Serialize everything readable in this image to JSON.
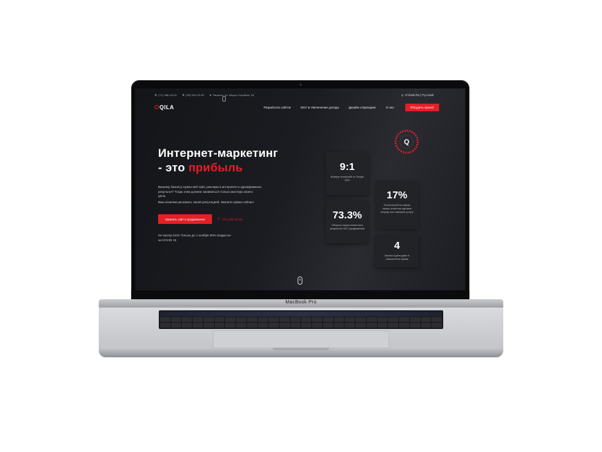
{
  "device": {
    "brand_label": "MacBook Pro"
  },
  "topbar": {
    "phone1": "(71) 288-43-00",
    "phone2": "(99) 900-20-50",
    "address": "Ташкент, ул. Мирзо Улугбека, 64",
    "languages": "O'zbekcha | Русский"
  },
  "navbar": {
    "logo": "QILA",
    "links": [
      "Разработка сайтов",
      "SEO & Увеличение дохода",
      "Дизайн и Брендинг",
      "О нас"
    ],
    "cta": "Обсудить проект"
  },
  "hero": {
    "title_line1": "Интернет-маркетинг",
    "title_line2_prefix": "- это ",
    "title_line2_accent": "прибыль",
    "desc1": "Вашему бизнесу нужен веб сайт, реклама в интернете и одновременно результат? Тогда этим должен заниматься только мастера своего дела.",
    "desc2": "Вам незачем рисковать своей репутацией. Звоните прямо сейчас!",
    "button": "Заказать сайт и продвижение",
    "phone": "(71) 288 43 00",
    "note": "Не пропустите! Только до 1 ноября 30% скидки из-за COVID 19"
  },
  "stats": [
    {
      "value": "9:1",
      "caption": "Возврат вложений от Google SEO"
    },
    {
      "value": "17%",
      "caption": "Посетителей на сайтах наших клиентов сделали покупку или заказали услугу"
    },
    {
      "value": "73.3%",
      "caption": "Оборота наших клиентов в результате SEO продвижения"
    },
    {
      "value": "4",
      "caption": "Звонка в день даже в назначенное время"
    }
  ],
  "badge": {
    "logo_letter": "Q"
  },
  "colors": {
    "accent": "#e41f26",
    "background": "#1b1c21",
    "card": "#222327"
  },
  "icons": {
    "phone": "phone-icon",
    "location": "location-icon",
    "globe": "globe-icon",
    "mouse": "scroll-mouse-icon"
  }
}
